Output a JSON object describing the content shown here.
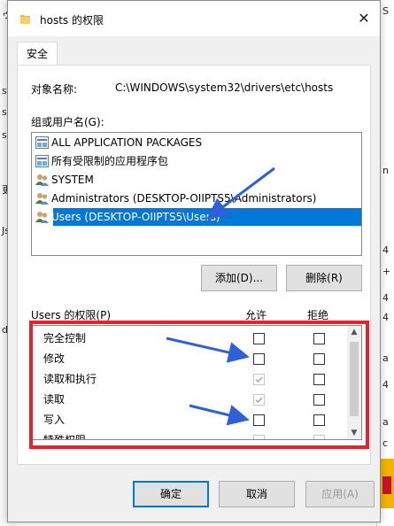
{
  "background": {
    "left_fragments": [
      "ゥ",
      "s",
      "s",
      "s",
      "更",
      "Js",
      "d"
    ],
    "right_fragments": [
      "S",
      "n",
      "4",
      "+",
      "4",
      "4",
      "a",
      "4",
      "a",
      "c"
    ]
  },
  "dialog": {
    "title": "hosts 的权限",
    "close_glyph": "✕",
    "tab_label": "安全",
    "object_name_label": "对象名称:",
    "object_name_value": "C:\\WINDOWS\\system32\\drivers\\etc\\hosts",
    "groups_label": "组或用户名(G):",
    "groups": [
      {
        "label": "ALL APPLICATION PACKAGES",
        "icon": "app-package-icon",
        "selected": false
      },
      {
        "label": "所有受限制的应用程序包",
        "icon": "app-package-icon",
        "selected": false
      },
      {
        "label": "SYSTEM",
        "icon": "users-icon",
        "selected": false
      },
      {
        "label": "Administrators (DESKTOP-OIIPTS5\\Administrators)",
        "icon": "users-icon",
        "selected": false
      },
      {
        "label": "Users (DESKTOP-OIIPTS5\\Users)",
        "icon": "users-icon",
        "selected": true
      }
    ],
    "add_button": "添加(D)...",
    "remove_button": "删除(R)",
    "permissions_label": "Users 的权限(P)",
    "allow_header": "允许",
    "deny_header": "拒绝",
    "permissions": [
      {
        "name": "完全控制",
        "allow": false,
        "deny": false,
        "allow_disabled": false
      },
      {
        "name": "修改",
        "allow": false,
        "deny": false,
        "allow_disabled": false
      },
      {
        "name": "读取和执行",
        "allow": true,
        "deny": false,
        "allow_disabled": true
      },
      {
        "name": "读取",
        "allow": true,
        "deny": false,
        "allow_disabled": true
      },
      {
        "name": "写入",
        "allow": false,
        "deny": false,
        "allow_disabled": false
      },
      {
        "name": "特殊权限",
        "allow": false,
        "deny": false,
        "allow_disabled": true
      }
    ],
    "ok_button": "确定",
    "cancel_button": "取消",
    "apply_button": "应用(A)"
  },
  "colors": {
    "selection": "#0078d7",
    "highlight_frame": "#e8212a",
    "arrow": "#2f5fd9"
  }
}
